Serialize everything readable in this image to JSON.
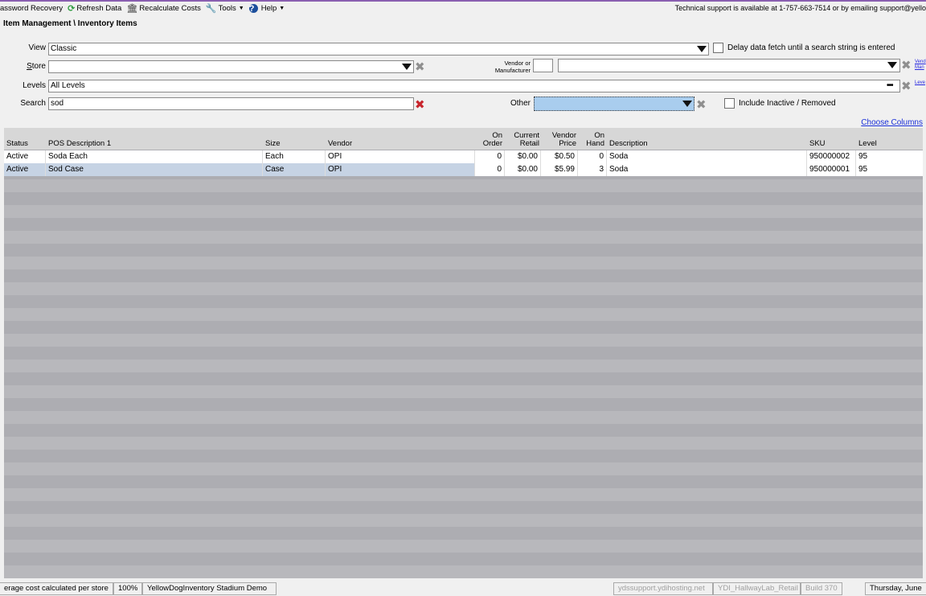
{
  "menu": {
    "password_recovery": "assword Recovery",
    "refresh": "Refresh Data",
    "recalc": "Recalculate Costs",
    "tools": "Tools",
    "help": "Help",
    "support": "Technical support is available at 1-757-663-7514 or by emailing support@yello"
  },
  "breadcrumb": "Item Management \\ Inventory Items",
  "filters": {
    "view_label": "View",
    "view_value": "Classic",
    "delay_label": "Delay data fetch until a search string is entered",
    "store_label": "Store",
    "store_value": "",
    "vendor_label_1": "Vendor or",
    "vendor_label_2": "Manufacturer",
    "vendor_code": "",
    "vendor_value": "",
    "vendor_link_1": "Vend",
    "vendor_link_2": "Man",
    "levels_label": "Levels",
    "levels_value": "All Levels",
    "levels_button": "•••",
    "levels_link": "Leve",
    "search_label": "Search",
    "search_value": "sod",
    "other_label": "Other",
    "other_value": "",
    "inactive_label": "Include Inactive / Removed"
  },
  "choose_columns": "Choose Columns",
  "grid": {
    "headers": {
      "status": "Status",
      "pos": "POS Description 1",
      "size": "Size",
      "vendor": "Vendor",
      "on_order": "On\nOrder",
      "retail": "Current\nRetail",
      "vprice": "Vendor\nPrice",
      "on_hand": "On\nHand",
      "desc": "Description",
      "sku": "SKU",
      "level": "Level"
    },
    "rows": [
      {
        "status": "Active",
        "pos": "Soda Each",
        "size": "Each",
        "vendor": "OPI",
        "on_order": "0",
        "retail": "$0.00",
        "vprice": "$0.50",
        "on_hand": "0",
        "desc": "Soda",
        "sku": "950000002",
        "level": "95"
      },
      {
        "status": "Active",
        "pos": "Sod Case",
        "size": "Case",
        "vendor": "OPI",
        "on_order": "0",
        "retail": "$0.00",
        "vprice": "$5.99",
        "on_hand": "3",
        "desc": "Soda",
        "sku": "950000001",
        "level": "95"
      }
    ]
  },
  "status": {
    "cost_mode": "erage cost calculated per store",
    "zoom": "100%",
    "database": "YellowDogInventory Stadium Demo",
    "host": "ydssupport.ydihosting.net",
    "instance": "YDI_HallwayLab_Retail",
    "build": "Build 370",
    "date": "Thursday, June"
  },
  "colors": {
    "accent_line": "#8a5fb0",
    "selected_row": "#c6d3e4",
    "link": "#1a2fd8",
    "clear_red": "#c8262d"
  }
}
